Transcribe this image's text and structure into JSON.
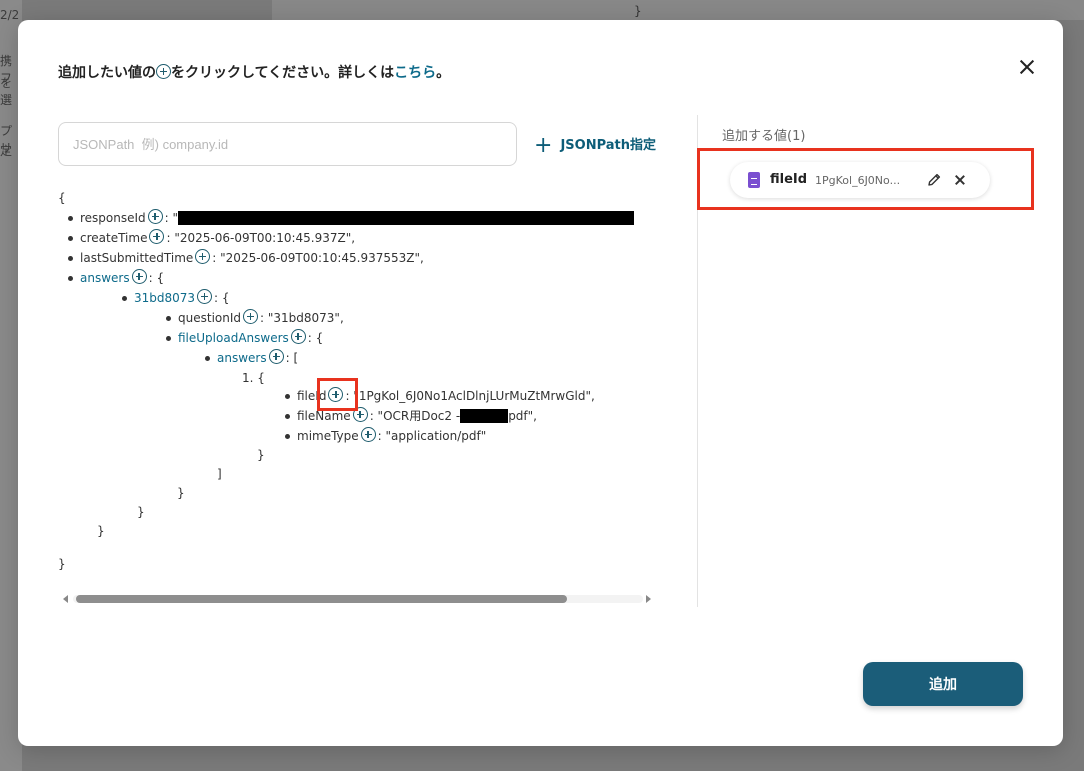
{
  "background": {
    "fragments": [
      "2/2",
      "携フ",
      "を選",
      "プリ",
      "定"
    ],
    "brace": "}"
  },
  "modal": {
    "title_before": "追加したい値の",
    "title_after": "をクリックしてください。詳しくは",
    "title_link": "こちら",
    "title_end": "。",
    "jsonpath_placeholder": "JSONPath  例) company.id",
    "jsonpath_button": "JSONPath指定",
    "jsonpath_button_icon": "+",
    "add_button": "追加"
  },
  "tree": {
    "open": "{",
    "responseId_key": "responseId",
    "responseId_sep": ": \"",
    "createTime_key": "createTime",
    "createTime_val": ": \"2025-06-09T00:10:45.937Z\",",
    "lastSubmittedTime_key": "lastSubmittedTime",
    "lastSubmittedTime_val": ": \"2025-06-09T00:10:45.937553Z\",",
    "answers_key": "answers",
    "answers_val": ": {",
    "qid_key": "31bd8073",
    "qid_val": ": {",
    "questionId_key": "questionId",
    "questionId_val": ": \"31bd8073\",",
    "fileUploadAnswers_key": "fileUploadAnswers",
    "fileUploadAnswers_val": ": {",
    "inner_answers_key": "answers",
    "inner_answers_val": ": [",
    "item_index": "1. {",
    "fileId_key": "fileId",
    "fileId_val": ": \"1PgKol_6J0No1AclDlnjLUrMuZtMrwGld\",",
    "fileName_key": "fileName",
    "fileName_val_prefix": ": \"OCR用Doc2 -",
    "fileName_val_suffix": "pdf\",",
    "mimeType_key": "mimeType",
    "mimeType_val": ": \"application/pdf\"",
    "close_item": "}",
    "close_array": "]",
    "close_fua": "}",
    "close_qid": "}",
    "close_answers": "}",
    "close_root": "}"
  },
  "added_panel": {
    "header": "追加する値(1)",
    "chip_name": "fileId",
    "chip_value": "1PgKol_6J0No..."
  },
  "colors": {
    "accent": "#1b5d79",
    "link": "#0d6a8a",
    "highlight": "#e8321e",
    "doc_icon": "#7a4fd0"
  }
}
